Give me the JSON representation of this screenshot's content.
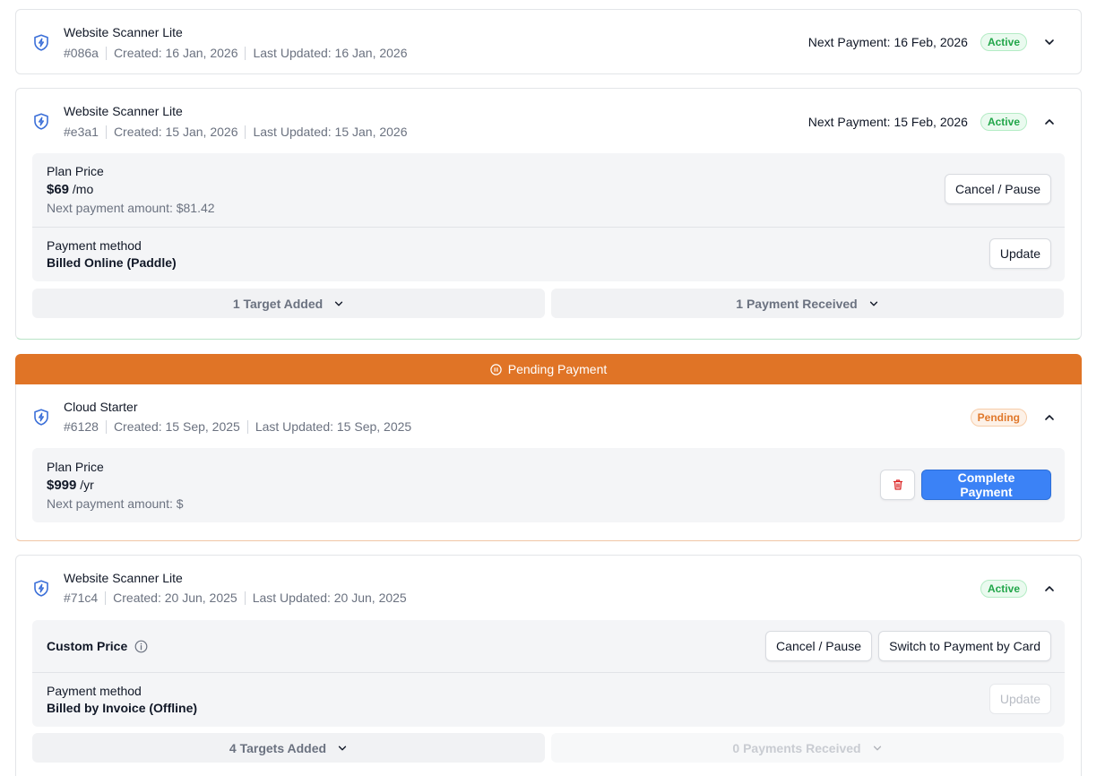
{
  "subscriptions": [
    {
      "title": "Website Scanner Lite",
      "id": "#086a",
      "created": "Created: 16 Jan, 2026",
      "updated": "Last Updated: 16 Jan, 2026",
      "next_payment": "Next Payment: 16 Feb, 2026",
      "status": "Active",
      "expanded": false
    },
    {
      "title": "Website Scanner Lite",
      "id": "#e3a1",
      "created": "Created: 15 Jan, 2026",
      "updated": "Last Updated: 15 Jan, 2026",
      "next_payment": "Next Payment: 15 Feb, 2026",
      "status": "Active",
      "expanded": true,
      "plan_price_label": "Plan Price",
      "price": "$69",
      "price_unit": "/mo",
      "next_amount": "Next payment amount: $81.42",
      "cancel_label": "Cancel / Pause",
      "payment_method_label": "Payment method",
      "payment_method": "Billed Online (Paddle)",
      "update_label": "Update",
      "targets": "1 Target Added",
      "payments": "1 Payment Received"
    },
    {
      "banner": "Pending Payment",
      "title": "Cloud Starter",
      "id": "#6128",
      "created": "Created: 15 Sep, 2025",
      "updated": "Last Updated: 15 Sep, 2025",
      "status": "Pending",
      "expanded": true,
      "plan_price_label": "Plan Price",
      "price": "$999",
      "price_unit": "/yr",
      "next_amount": "Next payment amount: $",
      "complete_label": "Complete Payment"
    },
    {
      "title": "Website Scanner Lite",
      "id": "#71c4",
      "created": "Created: 20 Jun, 2025",
      "updated": "Last Updated: 20 Jun, 2025",
      "status": "Active",
      "expanded": true,
      "custom_price_label": "Custom Price",
      "cancel_label": "Cancel / Pause",
      "switch_label": "Switch to Payment by Card",
      "payment_method_label": "Payment method",
      "payment_method": "Billed by Invoice (Offline)",
      "update_label": "Update",
      "targets": "4 Targets Added",
      "payments": "0 Payments Received"
    }
  ],
  "colors": {
    "accent_blue": "#3b82f6",
    "pending_orange": "#e07426",
    "active_green": "#22a64a"
  },
  "icons": [
    "shield-bolt-icon",
    "chevron-down-icon",
    "chevron-up-icon",
    "pause-circle-icon",
    "trash-icon",
    "info-icon"
  ]
}
